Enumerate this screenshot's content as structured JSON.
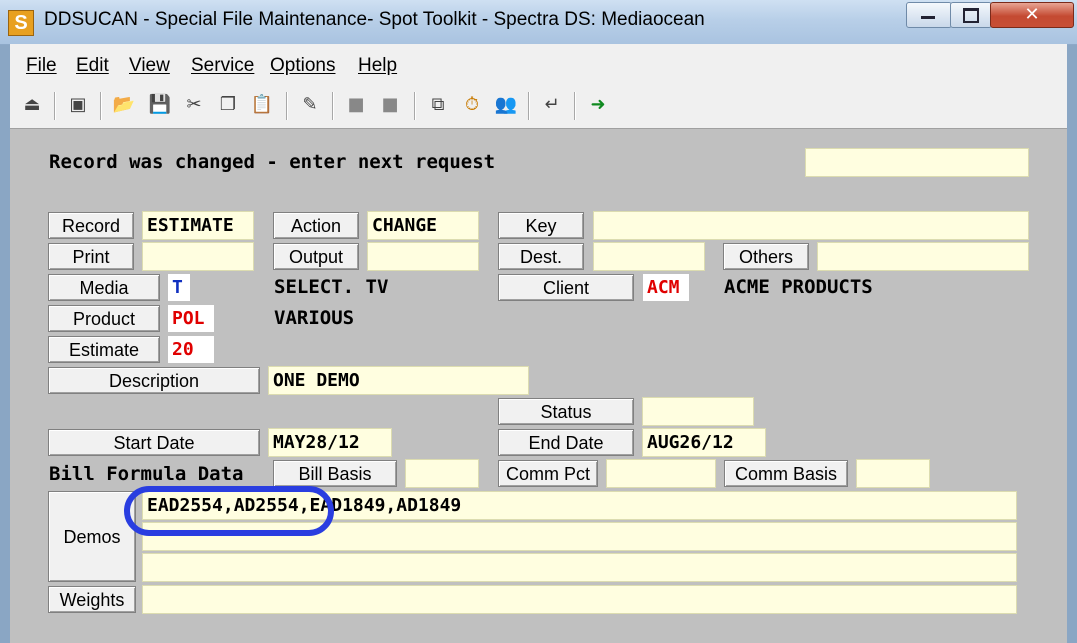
{
  "window": {
    "title": "DDSUCAN - Special File Maintenance- Spot Toolkit - Spectra DS: Mediaocean",
    "app_icon_letter": "S",
    "close_glyph": "✕"
  },
  "menu": [
    "File",
    "Edit",
    "View",
    "Service",
    "Options",
    "Help"
  ],
  "toolbar_icons": [
    "send-icon",
    "unavailable-icon",
    "open-folder-icon",
    "save-icon",
    "cut-icon",
    "copy-icon",
    "paste-icon",
    "tools-icon",
    "disabled-icon",
    "disabled-icon",
    "copy-screen-icon",
    "timer-icon",
    "users-icon",
    "return-icon",
    "exit-icon"
  ],
  "toolbar_glyphs": [
    "⏏",
    "▣",
    "📂",
    "💾",
    "✂",
    "❐",
    "📋",
    "✎",
    "■",
    "■",
    "⧉",
    "⏱",
    "👥",
    "↵",
    "➜"
  ],
  "status": {
    "message": "Record was changed - enter next request",
    "right_field": ""
  },
  "form": {
    "record_label": "Record",
    "record_value": "ESTIMATE",
    "action_label": "Action",
    "action_value": "CHANGE",
    "key_label": "Key",
    "key_value": "",
    "print_label": "Print",
    "print_value": "",
    "output_label": "Output",
    "output_value": "",
    "dest_label": "Dest.",
    "dest_value": "",
    "others_label": "Others",
    "others_value": "",
    "media_label": "Media",
    "media_value": "T",
    "media_name": "SELECT. TV",
    "client_label": "Client",
    "client_value": "ACM",
    "client_name": "ACME PRODUCTS",
    "product_label": "Product",
    "product_value": "POL",
    "product_name": "VARIOUS",
    "estimate_label": "Estimate",
    "estimate_value": "20",
    "description_label": "Description",
    "description_value": "ONE DEMO",
    "status_label": "Status",
    "status_value": "",
    "start_date_label": "Start Date",
    "start_date_value": "MAY28/12",
    "end_date_label": "End Date",
    "end_date_value": "AUG26/12",
    "bill_formula_label": "Bill Formula Data",
    "bill_basis_label": "Bill Basis",
    "bill_basis_value": "",
    "comm_pct_label": "Comm Pct",
    "comm_pct_value": "",
    "comm_basis_label": "Comm Basis",
    "comm_basis_value": "",
    "demos_label": "Demos",
    "demos_lines": [
      "EAD2554,AD2554,EAD1849,AD1849",
      "",
      ""
    ],
    "weights_label": "Weights",
    "weights_value": ""
  },
  "colors": {
    "highlight_oval": "#2a3ee0",
    "code_red": "#e00000",
    "field_bg": "#fffee0"
  }
}
